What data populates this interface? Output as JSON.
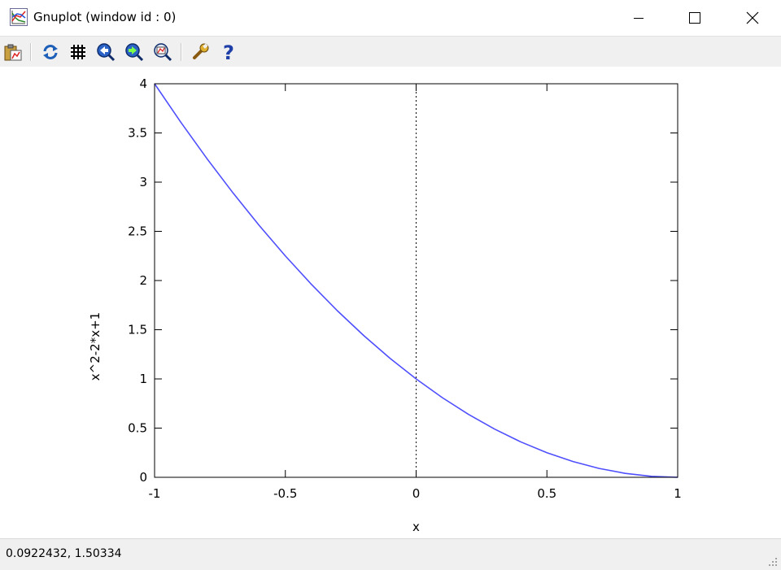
{
  "window": {
    "title": "Gnuplot (window id : 0)",
    "controls": [
      "minimize",
      "maximize",
      "close"
    ]
  },
  "toolbar": {
    "buttons": [
      {
        "name": "copy-to-clipboard",
        "icon": "clipboard-icon"
      },
      {
        "name": "replot",
        "icon": "refresh-icon"
      },
      {
        "name": "toggle-grid",
        "icon": "grid-icon"
      },
      {
        "name": "previous-zoom",
        "icon": "zoom-previous-icon"
      },
      {
        "name": "next-zoom",
        "icon": "zoom-next-icon"
      },
      {
        "name": "autoscale",
        "icon": "autoscale-icon"
      },
      {
        "name": "options",
        "icon": "wrench-icon"
      },
      {
        "name": "help",
        "icon": "help-icon"
      }
    ]
  },
  "status": {
    "coordinates": "0.0922432,  1.50334"
  },
  "chart_data": {
    "type": "line",
    "title": "",
    "xlabel": "x",
    "ylabel": "x^2-2*x+1",
    "xlim": [
      -1,
      1
    ],
    "ylim": [
      0,
      4
    ],
    "xticks": [
      "-1",
      "-0.5",
      "0",
      "0.5",
      "1"
    ],
    "yticks": [
      "0",
      "0.5",
      "1",
      "1.5",
      "2",
      "2.5",
      "3",
      "3.5",
      "4"
    ],
    "xtick_values": [
      -1,
      -0.5,
      0,
      0.5,
      1
    ],
    "ytick_values": [
      0,
      0.5,
      1,
      1.5,
      2,
      2.5,
      3,
      3.5,
      4
    ],
    "zero_axis": "x=0 dotted",
    "grid": false,
    "series": [
      {
        "color": "#4f4fff",
        "x": [
          -1,
          -0.9,
          -0.8,
          -0.7,
          -0.6,
          -0.5,
          -0.4,
          -0.3,
          -0.2,
          -0.1,
          0,
          0.1,
          0.2,
          0.3,
          0.4,
          0.5,
          0.6,
          0.7,
          0.8,
          0.9,
          1
        ],
        "y": [
          4,
          3.61,
          3.24,
          2.89,
          2.56,
          2.25,
          1.96,
          1.69,
          1.44,
          1.21,
          1,
          0.81,
          0.64,
          0.49,
          0.36,
          0.25,
          0.16,
          0.09,
          0.04,
          0.01,
          0
        ]
      }
    ]
  }
}
